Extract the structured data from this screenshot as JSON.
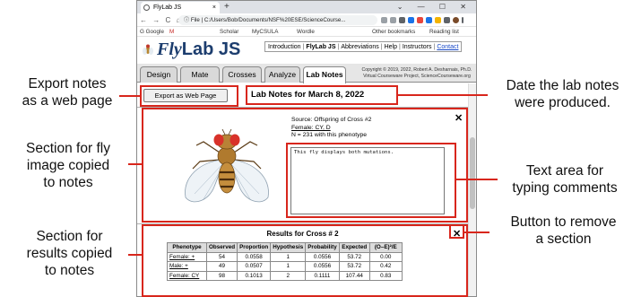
{
  "annotations": {
    "export": "Export notes\nas a web page",
    "fly_section": "Section for fly\nimage copied\nto notes",
    "results_section": "Section for\nresults copied\nto notes",
    "date": "Date the lab notes\nwere produced.",
    "text_area": "Text area for\ntyping comments",
    "remove": "Button to remove\na section",
    "accent_color": "#d8261c"
  },
  "browser": {
    "tab_title": "FlyLab JS",
    "tab_close": "×",
    "new_tab": "+",
    "window_controls": "⌄ — ☐ ✕",
    "nav": "← → C ⌂",
    "url": "ⓘ File | C:/Users/Bob/Documents/NSF%20ESE/ScienceCourse...",
    "bookmarks": [
      "G Google",
      "M",
      "Scholar",
      "MyCSULA",
      "Wordle"
    ],
    "other_bookmarks": "Other bookmarks",
    "reading_list": "Reading list"
  },
  "app": {
    "logo_fly": "Fly",
    "logo_rest": "Lab JS",
    "topnav": [
      "Introduction",
      "FlyLab JS",
      "Abbreviations",
      "Help",
      "Instructors",
      "Contact"
    ],
    "tabs": [
      "Design",
      "Mate",
      "Crosses",
      "Analyze",
      "Lab Notes"
    ],
    "active_tab": "Lab Notes",
    "copyright": "Copyright © 2019, 2022, Robert A. Desharnais, Ph.D.\nVirtual Courseware Project, ScienceCourseware.org"
  },
  "notes": {
    "export_button": "Export as Web Page",
    "title": "Lab Notes for March 8, 2022",
    "fly_section": {
      "source": "Source:  Offspring of Cross #2",
      "female": "Female: CY, D",
      "count": "N = 231 with this phenotype",
      "comment": "This fly displays both mutations.",
      "close": "✕"
    },
    "results": {
      "title": "Results for Cross # 2",
      "close": "✕",
      "headers": [
        "Phenotype",
        "Observed",
        "Proportion",
        "Hypothesis",
        "Probability",
        "Expected",
        "(O–E)²/E"
      ],
      "rows": [
        [
          "Female: +",
          "54",
          "0.0558",
          "1",
          "0.0556",
          "53.72",
          "0.00"
        ],
        [
          "Male: +",
          "49",
          "0.0507",
          "1",
          "0.0556",
          "53.72",
          "0.42"
        ],
        [
          "Female: CY",
          "98",
          "0.1013",
          "2",
          "0.1111",
          "107.44",
          "0.83"
        ]
      ]
    }
  }
}
